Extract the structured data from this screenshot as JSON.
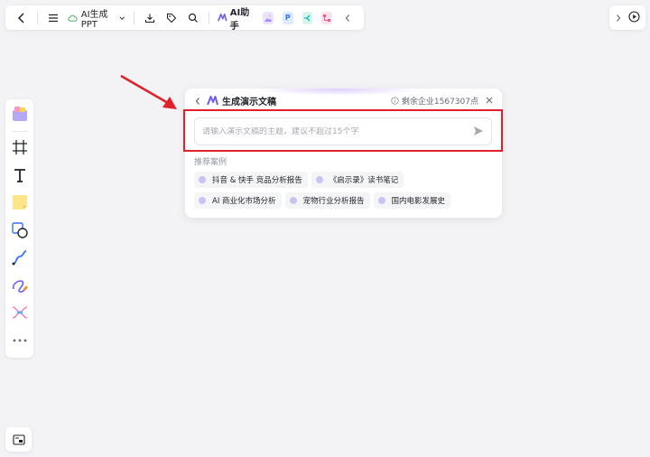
{
  "toolbar": {
    "doc_title": "AI生成PPT",
    "ai_assistant_label": "AI助手"
  },
  "panel": {
    "title": "生成演示文稿",
    "remaining_points": "剩余企业1567307点",
    "input_placeholder": "请输入演示文稿的主题，建议不超过15个字",
    "examples_label": "推荐案例",
    "examples": [
      "抖音 & 快手 竞品分析报告",
      "《启示录》读书笔记",
      "AI 商业化市场分析",
      "宠物行业分析报告",
      "国内电影发展史"
    ]
  },
  "colors": {
    "annotation_red": "#e0202a",
    "accent_purple": "#6d5cf6",
    "background": "#f3f3f6"
  },
  "icons": {
    "back": "chevron-left-icon",
    "menu": "hamburger-icon",
    "cloud": "cloud-icon",
    "dropdown": "chevron-down-icon",
    "download": "download-icon",
    "tag": "tag-icon",
    "search": "search-icon",
    "send": "send-icon",
    "info": "info-icon",
    "close": "close-icon"
  }
}
